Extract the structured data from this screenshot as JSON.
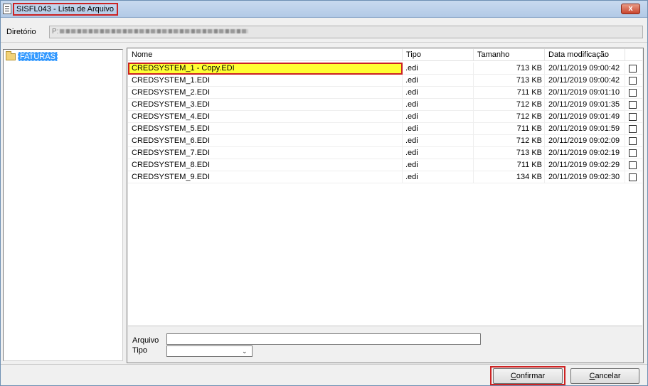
{
  "window": {
    "title": "SISFL043 - Lista de Arquivo",
    "close_symbol": "x"
  },
  "directory": {
    "label": "Diretório",
    "value_prefix": "P:"
  },
  "tree": {
    "items": [
      {
        "label": "FATURAS",
        "icon": "folder-icon"
      }
    ]
  },
  "file_list": {
    "columns": [
      "Nome",
      "Tipo",
      "Tamanho",
      "Data modificação"
    ],
    "rows": [
      {
        "name": "CREDSYSTEM_1 - Copy.EDI",
        "type": ".edi",
        "size": "713 KB",
        "date": "20/11/2019 09:00:42",
        "checked": false
      },
      {
        "name": "CREDSYSTEM_1.EDI",
        "type": ".edi",
        "size": "713 KB",
        "date": "20/11/2019 09:00:42",
        "checked": false
      },
      {
        "name": "CREDSYSTEM_2.EDI",
        "type": ".edi",
        "size": "711 KB",
        "date": "20/11/2019 09:01:10",
        "checked": false
      },
      {
        "name": "CREDSYSTEM_3.EDI",
        "type": ".edi",
        "size": "712 KB",
        "date": "20/11/2019 09:01:35",
        "checked": false
      },
      {
        "name": "CREDSYSTEM_4.EDI",
        "type": ".edi",
        "size": "712 KB",
        "date": "20/11/2019 09:01:49",
        "checked": false
      },
      {
        "name": "CREDSYSTEM_5.EDI",
        "type": ".edi",
        "size": "711 KB",
        "date": "20/11/2019 09:01:59",
        "checked": false
      },
      {
        "name": "CREDSYSTEM_6.EDI",
        "type": ".edi",
        "size": "712 KB",
        "date": "20/11/2019 09:02:09",
        "checked": false
      },
      {
        "name": "CREDSYSTEM_7.EDI",
        "type": ".edi",
        "size": "713 KB",
        "date": "20/11/2019 09:02:19",
        "checked": false
      },
      {
        "name": "CREDSYSTEM_8.EDI",
        "type": ".edi",
        "size": "711 KB",
        "date": "20/11/2019 09:02:29",
        "checked": false
      },
      {
        "name": "CREDSYSTEM_9.EDI",
        "type": ".edi",
        "size": "134 KB",
        "date": "20/11/2019 09:02:30",
        "checked": false
      }
    ],
    "selected_index": 0
  },
  "form": {
    "file_label": "Arquivo",
    "file_value": "",
    "type_label": "Tipo",
    "type_value": ""
  },
  "buttons": {
    "confirm_mnemonic": "C",
    "confirm_rest": "onfirmar",
    "cancel_mnemonic": "C",
    "cancel_rest": "ancelar"
  },
  "colors": {
    "highlight_outline": "#cc2222",
    "selected_row_bg": "#ffff33",
    "tree_selection_bg": "#3399ff"
  }
}
